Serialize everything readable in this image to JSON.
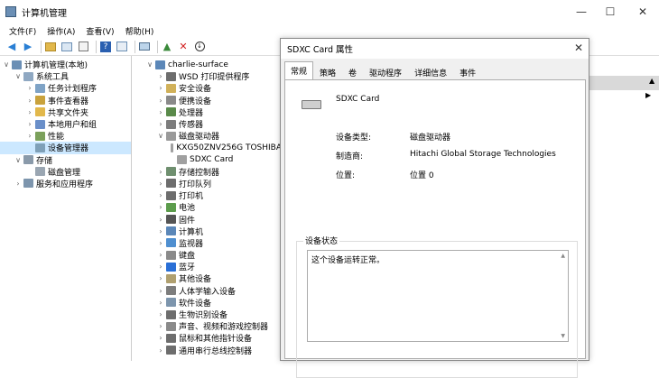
{
  "window": {
    "title": "计算机管理",
    "min": "—",
    "max": "☐",
    "close": "✕"
  },
  "menu": [
    "文件(F)",
    "操作(A)",
    "查看(V)",
    "帮助(H)"
  ],
  "left_tree": [
    {
      "label": "计算机管理(本地)",
      "exp": "∨",
      "indent": 0,
      "icon": "#6b8fb5",
      "name": "computer-management-icon"
    },
    {
      "label": "系统工具",
      "exp": "∨",
      "indent": 1,
      "icon": "#8fa8c2",
      "name": "system-tools-icon"
    },
    {
      "label": "任务计划程序",
      "exp": "›",
      "indent": 2,
      "icon": "#7fa3c6",
      "name": "task-scheduler-icon"
    },
    {
      "label": "事件查看器",
      "exp": "›",
      "indent": 2,
      "icon": "#c9a23c",
      "name": "event-viewer-icon"
    },
    {
      "label": "共享文件夹",
      "exp": "›",
      "indent": 2,
      "icon": "#e2b84b",
      "name": "shared-folder-icon"
    },
    {
      "label": "本地用户和组",
      "exp": "›",
      "indent": 2,
      "icon": "#6a8fc9",
      "name": "users-icon"
    },
    {
      "label": "性能",
      "exp": "›",
      "indent": 2,
      "icon": "#7ba05b",
      "name": "performance-icon"
    },
    {
      "label": "设备管理器",
      "exp": "",
      "indent": 2,
      "icon": "#7fa0b8",
      "name": "device-manager-icon",
      "selected": true
    },
    {
      "label": "存储",
      "exp": "∨",
      "indent": 1,
      "icon": "#8a9aaa",
      "name": "storage-icon"
    },
    {
      "label": "磁盘管理",
      "exp": "",
      "indent": 2,
      "icon": "#9aa6b2",
      "name": "disk-management-icon"
    },
    {
      "label": "服务和应用程序",
      "exp": "›",
      "indent": 1,
      "icon": "#7d95ad",
      "name": "services-icon"
    }
  ],
  "device_tree": [
    {
      "label": "charlie-surface",
      "exp": "∨",
      "indent": 0,
      "icon": "#5b87b8",
      "name": "computer-icon"
    },
    {
      "label": "WSD 打印提供程序",
      "exp": "›",
      "indent": 1,
      "icon": "#6d6d6d",
      "name": "printer-icon"
    },
    {
      "label": "安全设备",
      "exp": "›",
      "indent": 1,
      "icon": "#d1b15a",
      "name": "security-device-icon"
    },
    {
      "label": "便携设备",
      "exp": "›",
      "indent": 1,
      "icon": "#8a8a8a",
      "name": "portable-device-icon"
    },
    {
      "label": "处理器",
      "exp": "›",
      "indent": 1,
      "icon": "#5a8a4a",
      "name": "processor-icon"
    },
    {
      "label": "传感器",
      "exp": "›",
      "indent": 1,
      "icon": "#7d7d7d",
      "name": "sensor-icon"
    },
    {
      "label": "磁盘驱动器",
      "exp": "∨",
      "indent": 1,
      "icon": "#9a9a9a",
      "name": "disk-drive-icon"
    },
    {
      "label": "KXG50ZNV256G TOSHIBA",
      "exp": "",
      "indent": 2,
      "icon": "#a0a0a0",
      "name": "disk-icon"
    },
    {
      "label": "SDXC Card",
      "exp": "",
      "indent": 2,
      "icon": "#a0a0a0",
      "name": "sd-card-icon"
    },
    {
      "label": "存储控制器",
      "exp": "›",
      "indent": 1,
      "icon": "#6f8f6f",
      "name": "storage-controller-icon"
    },
    {
      "label": "打印队列",
      "exp": "›",
      "indent": 1,
      "icon": "#6d6d6d",
      "name": "print-queue-icon"
    },
    {
      "label": "打印机",
      "exp": "›",
      "indent": 1,
      "icon": "#6d6d6d",
      "name": "printer-icon"
    },
    {
      "label": "电池",
      "exp": "›",
      "indent": 1,
      "icon": "#5c9c4c",
      "name": "battery-icon"
    },
    {
      "label": "固件",
      "exp": "›",
      "indent": 1,
      "icon": "#555555",
      "name": "firmware-icon"
    },
    {
      "label": "计算机",
      "exp": "›",
      "indent": 1,
      "icon": "#5b87b8",
      "name": "computer-icon"
    },
    {
      "label": "监视器",
      "exp": "›",
      "indent": 1,
      "icon": "#4f8fd0",
      "name": "monitor-icon"
    },
    {
      "label": "键盘",
      "exp": "›",
      "indent": 1,
      "icon": "#8a8a8a",
      "name": "keyboard-icon"
    },
    {
      "label": "蓝牙",
      "exp": "›",
      "indent": 1,
      "icon": "#2a6fd6",
      "name": "bluetooth-icon"
    },
    {
      "label": "其他设备",
      "exp": "›",
      "indent": 1,
      "icon": "#b0a070",
      "name": "other-devices-icon"
    },
    {
      "label": "人体学输入设备",
      "exp": "›",
      "indent": 1,
      "icon": "#7d7d7d",
      "name": "hid-icon"
    },
    {
      "label": "软件设备",
      "exp": "›",
      "indent": 1,
      "icon": "#7d95ad",
      "name": "software-device-icon"
    },
    {
      "label": "生物识别设备",
      "exp": "›",
      "indent": 1,
      "icon": "#6d6d6d",
      "name": "biometric-icon"
    },
    {
      "label": "声音、视频和游戏控制器",
      "exp": "›",
      "indent": 1,
      "icon": "#8a8a8a",
      "name": "audio-icon"
    },
    {
      "label": "鼠标和其他指针设备",
      "exp": "›",
      "indent": 1,
      "icon": "#6d6d6d",
      "name": "mouse-icon"
    },
    {
      "label": "通用串行总线控制器",
      "exp": "›",
      "indent": 1,
      "icon": "#6d6d6d",
      "name": "usb-icon"
    }
  ],
  "dialog": {
    "title": "SDXC Card 属性",
    "close": "✕",
    "tabs": [
      "常规",
      "策略",
      "卷",
      "驱动程序",
      "详细信息",
      "事件"
    ],
    "device_name": "SDXC Card",
    "props": [
      {
        "label": "设备类型:",
        "value": "磁盘驱动器"
      },
      {
        "label": "制造商:",
        "value": "Hitachi Global Storage Technologies"
      },
      {
        "label": "位置:",
        "value": "位置 0"
      }
    ],
    "status_group": "设备状态",
    "status_text": "这个设备运转正常。"
  }
}
